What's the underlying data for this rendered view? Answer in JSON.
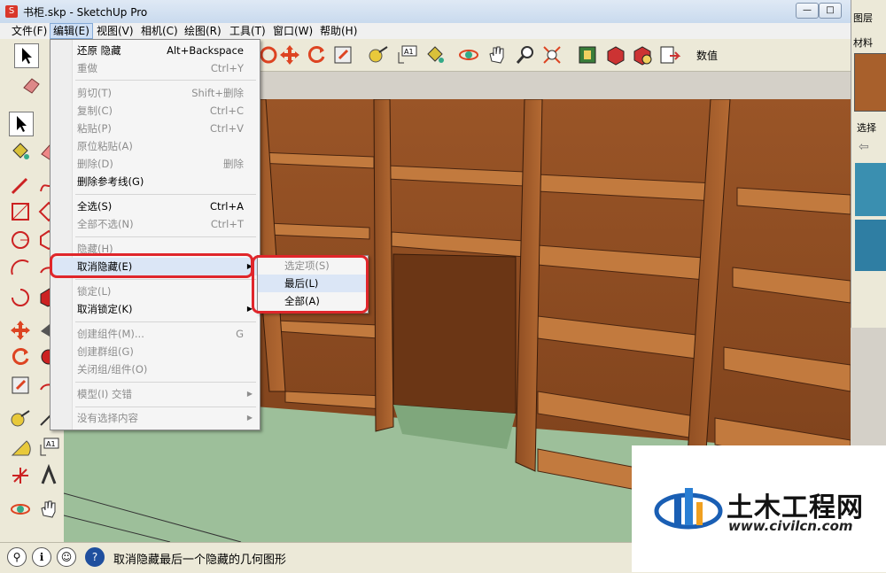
{
  "window": {
    "title": "书柜.skp - SketchUp Pro",
    "min": "—",
    "max": "□",
    "close": "✕"
  },
  "menubar": [
    "文件(F)",
    "编辑(E)",
    "视图(V)",
    "相机(C)",
    "绘图(R)",
    "工具(T)",
    "窗口(W)",
    "帮助(H)"
  ],
  "toolbar": {
    "value_label": "数值"
  },
  "edit_menu": {
    "items": [
      {
        "label": "还原 隐藏",
        "shortcut": "Alt+Backspace",
        "disabled": false
      },
      {
        "label": "重做",
        "shortcut": "Ctrl+Y",
        "disabled": true
      },
      {
        "label": "剪切(T)",
        "shortcut": "Shift+删除",
        "disabled": true
      },
      {
        "label": "复制(C)",
        "shortcut": "Ctrl+C",
        "disabled": true
      },
      {
        "label": "粘贴(P)",
        "shortcut": "Ctrl+V",
        "disabled": true
      },
      {
        "label": "原位粘贴(A)",
        "shortcut": "",
        "disabled": true
      },
      {
        "label": "删除(D)",
        "shortcut": "删除",
        "disabled": true
      },
      {
        "label": "删除参考线(G)",
        "shortcut": "",
        "disabled": false
      },
      {
        "label": "全选(S)",
        "shortcut": "Ctrl+A",
        "disabled": false
      },
      {
        "label": "全部不选(N)",
        "shortcut": "Ctrl+T",
        "disabled": true
      },
      {
        "label": "隐藏(H)",
        "shortcut": "",
        "disabled": true
      },
      {
        "label": "取消隐藏(E)",
        "shortcut": "",
        "disabled": false
      },
      {
        "label": "锁定(L)",
        "shortcut": "",
        "disabled": true
      },
      {
        "label": "取消锁定(K)",
        "shortcut": "",
        "disabled": false
      },
      {
        "label": "创建组件(M)...",
        "shortcut": "G",
        "disabled": true
      },
      {
        "label": "创建群组(G)",
        "shortcut": "",
        "disabled": true
      },
      {
        "label": "关闭组/组件(O)",
        "shortcut": "",
        "disabled": true
      },
      {
        "label": "模型(I) 交错",
        "shortcut": "",
        "disabled": true
      },
      {
        "label": "没有选择内容",
        "shortcut": "",
        "disabled": true
      }
    ]
  },
  "submenu": {
    "items": [
      {
        "label": "选定项(S)",
        "disabled": true
      },
      {
        "label": "最后(L)",
        "disabled": false
      },
      {
        "label": "全部(A)",
        "disabled": false
      }
    ]
  },
  "rightpanel": {
    "layers_tab": "图层",
    "materials_tab": "材料",
    "select_label": "选择"
  },
  "status": {
    "text": "取消隐藏最后一个隐藏的几何图形"
  },
  "watermark": {
    "cn": "土木工程网",
    "url": "www.civilcn.com"
  },
  "colors": {
    "wood": "#a8602c",
    "floor": "#9dbf9a",
    "highlight": "#e0262b",
    "water": "#3a8fb0"
  }
}
